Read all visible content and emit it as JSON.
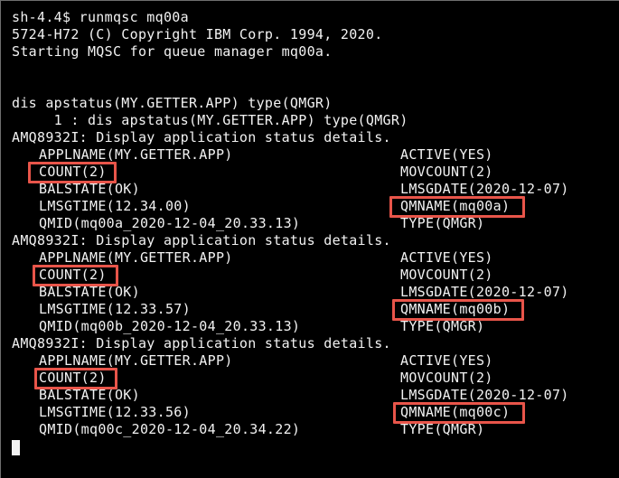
{
  "terminal": {
    "prompt_line": "sh-4.4$ runmqsc mq00a",
    "copyright_line": "5724-H72 (C) Copyright IBM Corp. 1994, 2020.",
    "starting_line": "Starting MQSC for queue manager mq00a.",
    "command_line": "dis apstatus(MY.GETTER.APP) type(QMGR)",
    "echo_line": "     1 : dis apstatus(MY.GETTER.APP) type(QMGR)",
    "blocks": [
      {
        "header": "AMQ8932I: Display application status details.",
        "applname": "APPLNAME(MY.GETTER.APP)",
        "active": "ACTIVE(YES)",
        "count": "COUNT(2)",
        "movcount": "MOVCOUNT(2)",
        "balstate": "BALSTATE(OK)",
        "lmsgdate": "LMSGDATE(2020-12-07)",
        "lmsgtime": "LMSGTIME(12.34.00)",
        "qmname": "QMNAME(mq00a)",
        "qmid": "QMID(mq00a_2020-12-04_20.33.13)",
        "type": "TYPE(QMGR)"
      },
      {
        "header": "AMQ8932I: Display application status details.",
        "applname": "APPLNAME(MY.GETTER.APP)",
        "active": "ACTIVE(YES)",
        "count": "COUNT(2)",
        "movcount": "MOVCOUNT(2)",
        "balstate": "BALSTATE(OK)",
        "lmsgdate": "LMSGDATE(2020-12-07)",
        "lmsgtime": "LMSGTIME(12.33.57)",
        "qmname": "QMNAME(mq00b)",
        "qmid": "QMID(mq00b_2020-12-04_20.33.13)",
        "type": "TYPE(QMGR)"
      },
      {
        "header": "AMQ8932I: Display application status details.",
        "applname": "APPLNAME(MY.GETTER.APP)",
        "active": "ACTIVE(YES)",
        "count": "COUNT(2)",
        "movcount": "MOVCOUNT(2)",
        "balstate": "BALSTATE(OK)",
        "lmsgdate": "LMSGDATE(2020-12-07)",
        "lmsgtime": "LMSGTIME(12.33.56)",
        "qmname": "QMNAME(mq00c)",
        "qmid": "QMID(mq00c_2020-12-04_20.34.22)",
        "type": "TYPE(QMGR)"
      }
    ]
  },
  "colors": {
    "background": "#000000",
    "text": "#f2f2f2",
    "highlight": "#e8554a"
  }
}
